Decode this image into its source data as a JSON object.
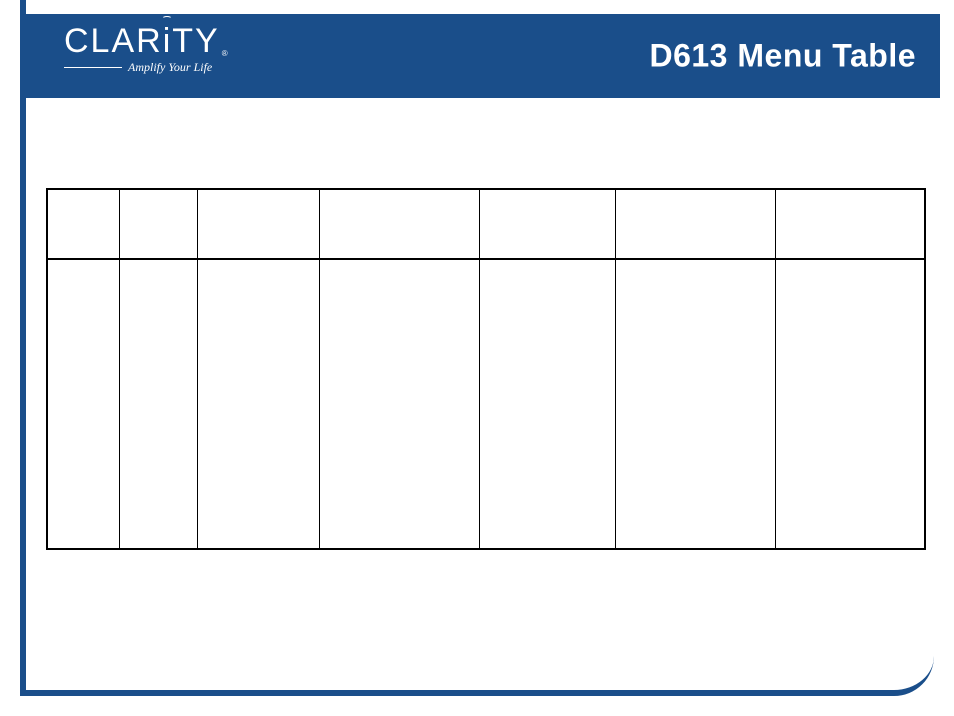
{
  "brand": {
    "name": "CLARiTY",
    "tagline": "Amplify Your Life",
    "registered": "®"
  },
  "page": {
    "title": "D613 Menu Table"
  },
  "table": {
    "headers": [
      "",
      "",
      "",
      "",
      "",
      "",
      ""
    ],
    "rows": [
      [
        "",
        "",
        "",
        "",
        "",
        "",
        ""
      ]
    ]
  }
}
